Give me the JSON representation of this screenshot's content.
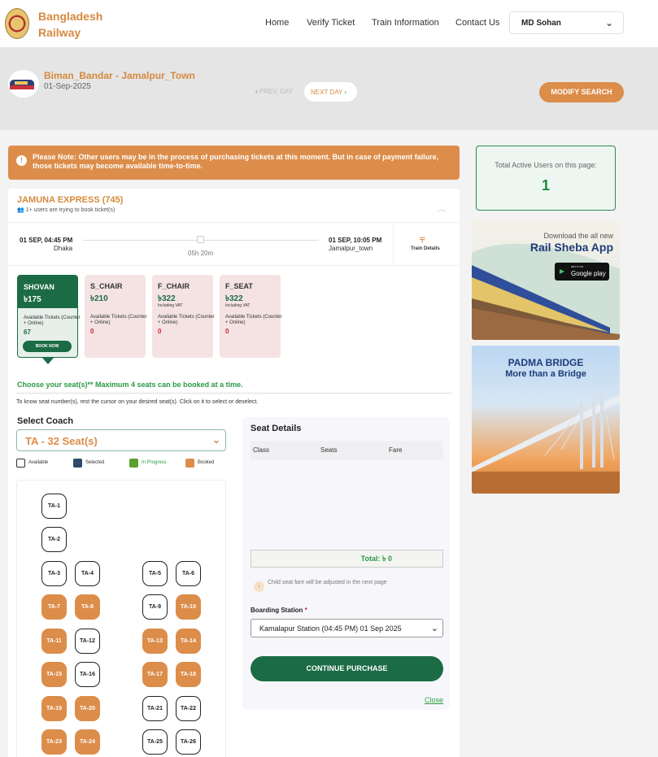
{
  "header": {
    "brand": "Bangladesh Railway",
    "nav": [
      "Home",
      "Verify Ticket",
      "Train Information",
      "Contact Us"
    ],
    "user": "MD Sohan"
  },
  "search": {
    "route": "Biman_Bandar - Jamalpur_Town",
    "date": "01-Sep-2025",
    "prev": "PREV. DAY",
    "next": "NEXT DAY",
    "modify": "MODIFY SEARCH"
  },
  "notice": "Please Note: Other users may be in the process of purchasing tickets at this moment. But in case of payment failure, those tickets may become available time-to-time.",
  "active": {
    "label": "Total Active Users on this page:",
    "value": "1"
  },
  "ads": {
    "ad1_line1": "Download the all new",
    "ad1_line2": "Rail Sheba App",
    "ad1_badge_small": "GET IT ON",
    "ad1_badge": "Google play",
    "ad2_line1": "PADMA BRIDGE",
    "ad2_line2": "More than a Bridge"
  },
  "train": {
    "name": "JAMUNA EXPRESS (745)",
    "users": "1+ users are trying to book ticket(s)",
    "dep_time": "01 SEP, 04:45 PM",
    "dep_station": "Dhaka",
    "duration": "05h 20m",
    "arr_time": "01 SEP, 10:05 PM",
    "arr_station": "Jamalpur_town",
    "details": "Train Details"
  },
  "classes": [
    {
      "name": "SHOVAN",
      "price": "৳175",
      "vat": "",
      "avail": "Available Tickets (Counter + Online)",
      "count": "67"
    },
    {
      "name": "S_CHAIR",
      "price": "৳210",
      "vat": "",
      "avail": "Available Tickets (Counter + Online)",
      "count": "0"
    },
    {
      "name": "F_CHAIR",
      "price": "৳322",
      "vat": "Including VAT",
      "avail": "Available Tickets (Counter + Online)",
      "count": "0"
    },
    {
      "name": "F_SEAT",
      "price": "৳322",
      "vat": "Including VAT",
      "avail": "Available Tickets (Counter + Online)",
      "count": "0"
    }
  ],
  "book_now": "BOOK NOW",
  "choose": "Choose your seat(s)** Maximum 4 seats can be booked at a time.",
  "know": "To know seat number(s), rest the cursor on your desired seat(s). Click on it to select or deselect.",
  "coach": {
    "label": "Select Coach",
    "value": "TA - 32 Seat(s)"
  },
  "legend": {
    "items": [
      "Available",
      "Selected",
      "In Progress",
      "Booked"
    ],
    "colors": [
      "#ffffff",
      "#2f4a6b",
      "#5aa02c",
      "#dc8d4a"
    ]
  },
  "seats": [
    {
      "label": "TA-1",
      "booked": false
    },
    {
      "label": "TA-2",
      "booked": false
    },
    {
      "label": "TA-3",
      "booked": false
    },
    {
      "label": "TA-4",
      "booked": false
    },
    {
      "label": "TA-5",
      "booked": false
    },
    {
      "label": "TA-6",
      "booked": false
    },
    {
      "label": "TA-7",
      "booked": true
    },
    {
      "label": "TA-8",
      "booked": true
    },
    {
      "label": "TA-9",
      "booked": false
    },
    {
      "label": "TA-10",
      "booked": true
    },
    {
      "label": "TA-11",
      "booked": true
    },
    {
      "label": "TA-12",
      "booked": false
    },
    {
      "label": "TA-13",
      "booked": true
    },
    {
      "label": "TA-14",
      "booked": true
    },
    {
      "label": "TA-15",
      "booked": true
    },
    {
      "label": "TA-16",
      "booked": false
    },
    {
      "label": "TA-17",
      "booked": true
    },
    {
      "label": "TA-18",
      "booked": true
    },
    {
      "label": "TA-19",
      "booked": true
    },
    {
      "label": "TA-20",
      "booked": true
    },
    {
      "label": "TA-21",
      "booked": false
    },
    {
      "label": "TA-22",
      "booked": false
    },
    {
      "label": "TA-23",
      "booked": true
    },
    {
      "label": "TA-24",
      "booked": true
    },
    {
      "label": "TA-25",
      "booked": false
    },
    {
      "label": "TA-26",
      "booked": false
    }
  ],
  "seat_details": {
    "title": "Seat Details",
    "cols": [
      "Class",
      "Seats",
      "Fare"
    ],
    "total": "Total: ৳ 0",
    "child_note": "Child seat fare will be adjusted in the next page",
    "boarding_label": "Boarding Station",
    "boarding_value": "Kamalapur Station (04:45 PM) 01 Sep 2025",
    "continue": "CONTINUE PURCHASE",
    "close": "Close"
  }
}
